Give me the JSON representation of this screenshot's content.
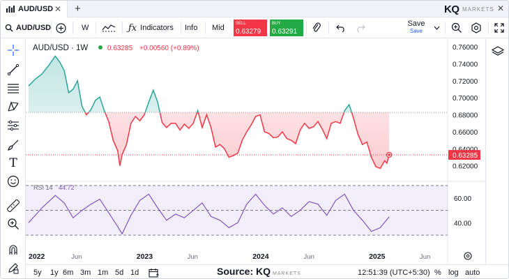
{
  "tab": {
    "title": "AUD/USD"
  },
  "brand": {
    "logo": "KQ",
    "sub": "MARKETS"
  },
  "toolbar": {
    "symbol": "AUD/USD",
    "interval": "W",
    "indicators_label": "Indicators",
    "info_label": "Info",
    "mid_label": "Mid",
    "sell_label": "SELL",
    "sell_price": "0.63279",
    "buy_label": "BUY",
    "buy_price": "0.63291",
    "save_label": "Save",
    "save_sub": "Save"
  },
  "legend": {
    "symbol_interval": "AUD/USD · 1W",
    "last": "0.63285",
    "change": "+0.00560 (+0.89%)"
  },
  "rsi_legend": {
    "label": "RSI 14",
    "value": "44.72"
  },
  "price_axis": {
    "ticks": [
      "0.76000",
      "0.74000",
      "0.72000",
      "0.70000",
      "0.68000",
      "0.66000",
      "0.64000",
      "0.62000"
    ],
    "current_label": "0.63285"
  },
  "rsi_axis": {
    "ticks": [
      "60.00",
      "40.00"
    ]
  },
  "time_axis": {
    "labels": [
      "2022",
      "Jun",
      "2023",
      "Jun",
      "2024",
      "Jun",
      "2025",
      "Jun"
    ]
  },
  "bottom": {
    "ranges": [
      "5y",
      "1y",
      "6m",
      "3m",
      "1m",
      "5d",
      "1d"
    ],
    "source_prefix": "Source: ",
    "source_logo": "KQ",
    "source_sub": "MARKETS",
    "time": "12:51:39 (UTC+5:30)",
    "pct": "%",
    "log": "log",
    "auto": "auto"
  },
  "colors": {
    "up": "#26a69a",
    "down": "#f23645",
    "rsi": "#7e57c2",
    "accent": "#2962ff"
  },
  "chart_data": [
    {
      "type": "area",
      "title": "AUD/USD · 1W",
      "baseline": 0.6828,
      "current": 0.63285,
      "ylim": [
        0.605,
        0.765
      ],
      "x_range": [
        "2022-01-01",
        "2025-07-31"
      ],
      "series": [
        {
          "x": [
            "2022-01-01",
            "2022-01-22",
            "2022-02-12",
            "2022-03-05",
            "2022-03-26",
            "2022-04-09",
            "2022-04-23",
            "2022-05-07",
            "2022-05-21",
            "2022-06-04",
            "2022-06-18",
            "2022-07-02",
            "2022-07-16",
            "2022-07-30",
            "2022-08-13",
            "2022-08-27",
            "2022-09-10",
            "2022-09-24",
            "2022-10-08",
            "2022-10-15",
            "2022-10-22",
            "2022-11-05",
            "2022-11-19",
            "2022-12-03",
            "2022-12-17",
            "2022-12-31",
            "2023-01-14",
            "2023-01-28",
            "2023-02-11",
            "2023-02-25",
            "2023-03-11",
            "2023-03-25",
            "2023-04-08",
            "2023-04-22",
            "2023-05-06",
            "2023-05-20",
            "2023-06-03",
            "2023-06-17",
            "2023-07-01",
            "2023-07-15",
            "2023-07-29",
            "2023-08-12",
            "2023-08-26",
            "2023-09-09",
            "2023-09-23",
            "2023-10-07",
            "2023-10-21",
            "2023-11-04",
            "2023-11-18",
            "2023-12-02",
            "2023-12-16",
            "2023-12-30",
            "2024-01-13",
            "2024-01-27",
            "2024-02-10",
            "2024-02-24",
            "2024-03-09",
            "2024-03-23",
            "2024-04-06",
            "2024-04-20",
            "2024-05-04",
            "2024-05-18",
            "2024-06-01",
            "2024-06-15",
            "2024-06-29",
            "2024-07-13",
            "2024-07-27",
            "2024-08-10",
            "2024-08-24",
            "2024-09-07",
            "2024-09-21",
            "2024-10-05",
            "2024-10-19",
            "2024-11-02",
            "2024-11-16",
            "2024-11-30",
            "2024-12-14",
            "2024-12-28",
            "2025-01-11",
            "2025-01-25",
            "2025-02-01",
            "2025-02-08"
          ],
          "y": [
            0.714,
            0.722,
            0.728,
            0.738,
            0.749,
            0.742,
            0.732,
            0.706,
            0.71,
            0.72,
            0.69,
            0.68,
            0.686,
            0.697,
            0.701,
            0.685,
            0.672,
            0.65,
            0.638,
            0.62,
            0.633,
            0.645,
            0.67,
            0.678,
            0.673,
            0.68,
            0.695,
            0.709,
            0.695,
            0.671,
            0.665,
            0.67,
            0.67,
            0.662,
            0.669,
            0.664,
            0.67,
            0.685,
            0.665,
            0.68,
            0.665,
            0.642,
            0.645,
            0.64,
            0.63,
            0.632,
            0.635,
            0.65,
            0.66,
            0.668,
            0.678,
            0.68,
            0.66,
            0.658,
            0.653,
            0.654,
            0.66,
            0.652,
            0.65,
            0.646,
            0.662,
            0.67,
            0.664,
            0.666,
            0.672,
            0.663,
            0.652,
            0.67,
            0.672,
            0.67,
            0.685,
            0.692,
            0.676,
            0.657,
            0.645,
            0.648,
            0.63,
            0.619,
            0.617,
            0.626,
            0.623,
            0.6329
          ]
        }
      ]
    },
    {
      "type": "line",
      "title": "RSI 14",
      "ylim": [
        25,
        70
      ],
      "levels": [
        30,
        50,
        70
      ],
      "x_range": [
        "2022-01-01",
        "2025-07-31"
      ],
      "series": [
        {
          "name": "RSI 14",
          "x": [
            "2022-01-01",
            "2022-02-12",
            "2022-03-26",
            "2022-04-23",
            "2022-05-21",
            "2022-06-18",
            "2022-07-16",
            "2022-08-13",
            "2022-09-10",
            "2022-10-08",
            "2022-10-22",
            "2022-11-19",
            "2022-12-17",
            "2023-01-14",
            "2023-02-11",
            "2023-03-11",
            "2023-04-08",
            "2023-05-06",
            "2023-06-03",
            "2023-07-01",
            "2023-07-29",
            "2023-08-26",
            "2023-09-23",
            "2023-10-21",
            "2023-11-18",
            "2023-12-16",
            "2024-01-13",
            "2024-02-10",
            "2024-03-09",
            "2024-04-06",
            "2024-05-04",
            "2024-06-01",
            "2024-06-29",
            "2024-07-27",
            "2024-08-24",
            "2024-09-21",
            "2024-10-19",
            "2024-11-16",
            "2024-12-14",
            "2025-01-11",
            "2025-02-08"
          ],
          "y": [
            40,
            52,
            62,
            56,
            44,
            50,
            55,
            59,
            48,
            37,
            31,
            46,
            58,
            63,
            52,
            42,
            47,
            44,
            50,
            56,
            45,
            42,
            36,
            40,
            55,
            63,
            54,
            47,
            52,
            45,
            50,
            57,
            55,
            46,
            58,
            63,
            50,
            42,
            33,
            36,
            44.72
          ]
        }
      ]
    }
  ]
}
